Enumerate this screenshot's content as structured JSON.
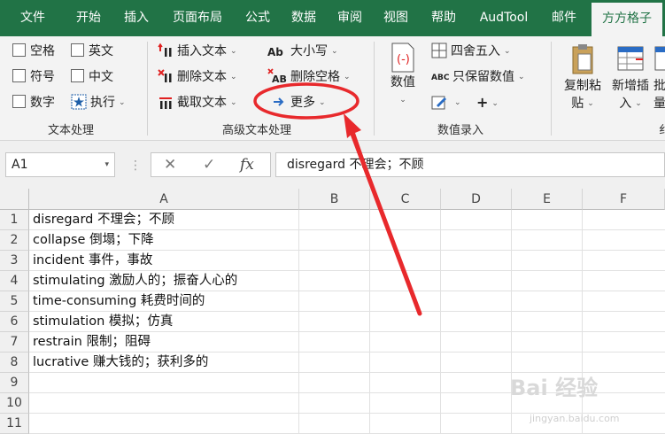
{
  "tabs": [
    {
      "label": "文件",
      "active": false
    },
    {
      "label": "开始",
      "active": false
    },
    {
      "label": "插入",
      "active": false
    },
    {
      "label": "页面布局",
      "active": false
    },
    {
      "label": "公式",
      "active": false
    },
    {
      "label": "数据",
      "active": false
    },
    {
      "label": "审阅",
      "active": false
    },
    {
      "label": "视图",
      "active": false
    },
    {
      "label": "帮助",
      "active": false
    },
    {
      "label": "AudTool",
      "active": false
    },
    {
      "label": "邮件",
      "active": false
    },
    {
      "label": "方方格子",
      "active": true
    }
  ],
  "ribbon": {
    "text_group": {
      "label": "文本处理",
      "checkboxes": [
        "空格",
        "英文",
        "符号",
        "中文",
        "数字"
      ],
      "execute_label": "执行"
    },
    "advanced_group": {
      "label": "高级文本处理",
      "insert_text": "插入文本",
      "delete_text": "删除文本",
      "extract_text": "截取文本",
      "case_label": "大小写",
      "delete_space": "删除空格",
      "more_label": "更多"
    },
    "numeric_group": {
      "label": "数值录入",
      "value_label": "数值",
      "round_label": "四舍五入",
      "keep_value": "只保留数值",
      "plus_label": "+"
    },
    "clipboard_group": {
      "copy_paste_line1": "复制粘",
      "copy_paste_line2": "贴",
      "insert_new_line1": "新增插",
      "insert_new_line2": "入",
      "batch_line1": "批",
      "batch_line2": "量",
      "partial_label": "纟"
    }
  },
  "formula_bar": {
    "name_box": "A1",
    "cancel_icon": "✕",
    "confirm_icon": "✓",
    "fx": "fx",
    "content": "disregard 不理会；不顾"
  },
  "sheet": {
    "columns": [
      "A",
      "B",
      "C",
      "D",
      "E",
      "F"
    ],
    "rows": [
      "1",
      "2",
      "3",
      "4",
      "5",
      "6",
      "7",
      "8",
      "9",
      "10",
      "11"
    ],
    "cells_a": [
      "disregard 不理会；不顾",
      "collapse 倒塌；下降",
      "incident 事件，事故",
      "stimulating 激励人的；振奋人心的",
      "time-consuming 耗费时间的",
      "stimulation 模拟；仿真",
      "restrain 限制；阻碍",
      "lucrative 赚大钱的；获利多的",
      "",
      "",
      ""
    ]
  },
  "colors": {
    "accent": "#217346",
    "annotation": "#e8292c"
  },
  "watermark": {
    "brand": "Bai 经验",
    "url": "jingyan.baidu.com"
  }
}
